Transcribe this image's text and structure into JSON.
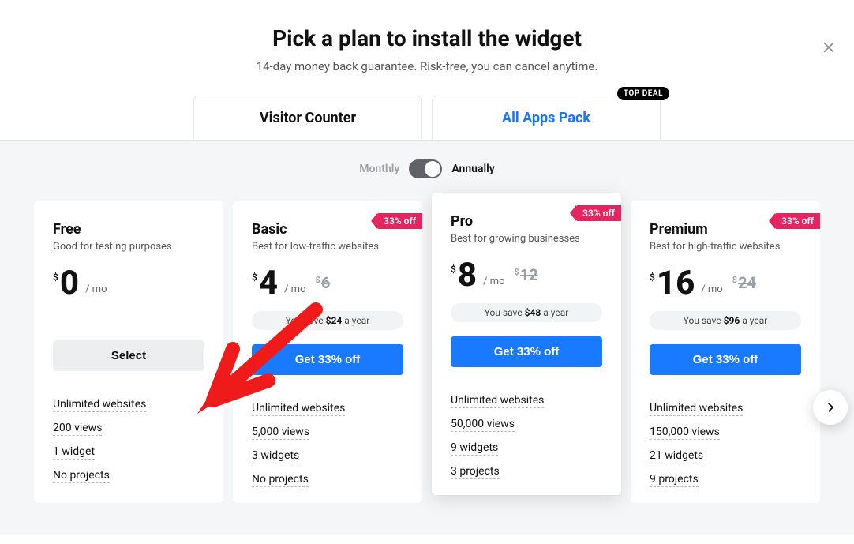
{
  "header": {
    "title": "Pick a plan to install the widget",
    "subtitle": "14-day money back guarantee. Risk-free, you can cancel anytime."
  },
  "tabs": {
    "active": "Visitor Counter",
    "inactive": "All Apps Pack",
    "top_deal_badge": "TOP DEAL"
  },
  "billing": {
    "monthly": "Monthly",
    "annually": "Annually",
    "selected": "annually"
  },
  "discount_label": "33% off",
  "plans": [
    {
      "name": "Free",
      "desc": "Good for testing purposes",
      "price": "0",
      "per": "/ mo",
      "cta": "Select",
      "features": [
        "Unlimited websites",
        "200 views",
        "1 widget",
        "No projects"
      ]
    },
    {
      "name": "Basic",
      "desc": "Best for low-traffic websites",
      "price": "4",
      "strike": "6",
      "per": "/ mo",
      "save_prefix": "You save ",
      "save_amount": "$24",
      "save_suffix": " a year",
      "cta": "Get 33% off",
      "features": [
        "Unlimited websites",
        "5,000 views",
        "3 widgets",
        "No projects"
      ]
    },
    {
      "name": "Pro",
      "desc": "Best for growing businesses",
      "price": "8",
      "strike": "12",
      "per": "/ mo",
      "save_prefix": "You save ",
      "save_amount": "$48",
      "save_suffix": " a year",
      "cta": "Get 33% off",
      "features": [
        "Unlimited websites",
        "50,000 views",
        "9 widgets",
        "3 projects"
      ]
    },
    {
      "name": "Premium",
      "desc": "Best for high-traffic websites",
      "price": "16",
      "strike": "24",
      "per": "/ mo",
      "save_prefix": "You save ",
      "save_amount": "$96",
      "save_suffix": " a year",
      "cta": "Get 33% off",
      "features": [
        "Unlimited websites",
        "150,000 views",
        "21 widgets",
        "9 projects"
      ]
    }
  ]
}
